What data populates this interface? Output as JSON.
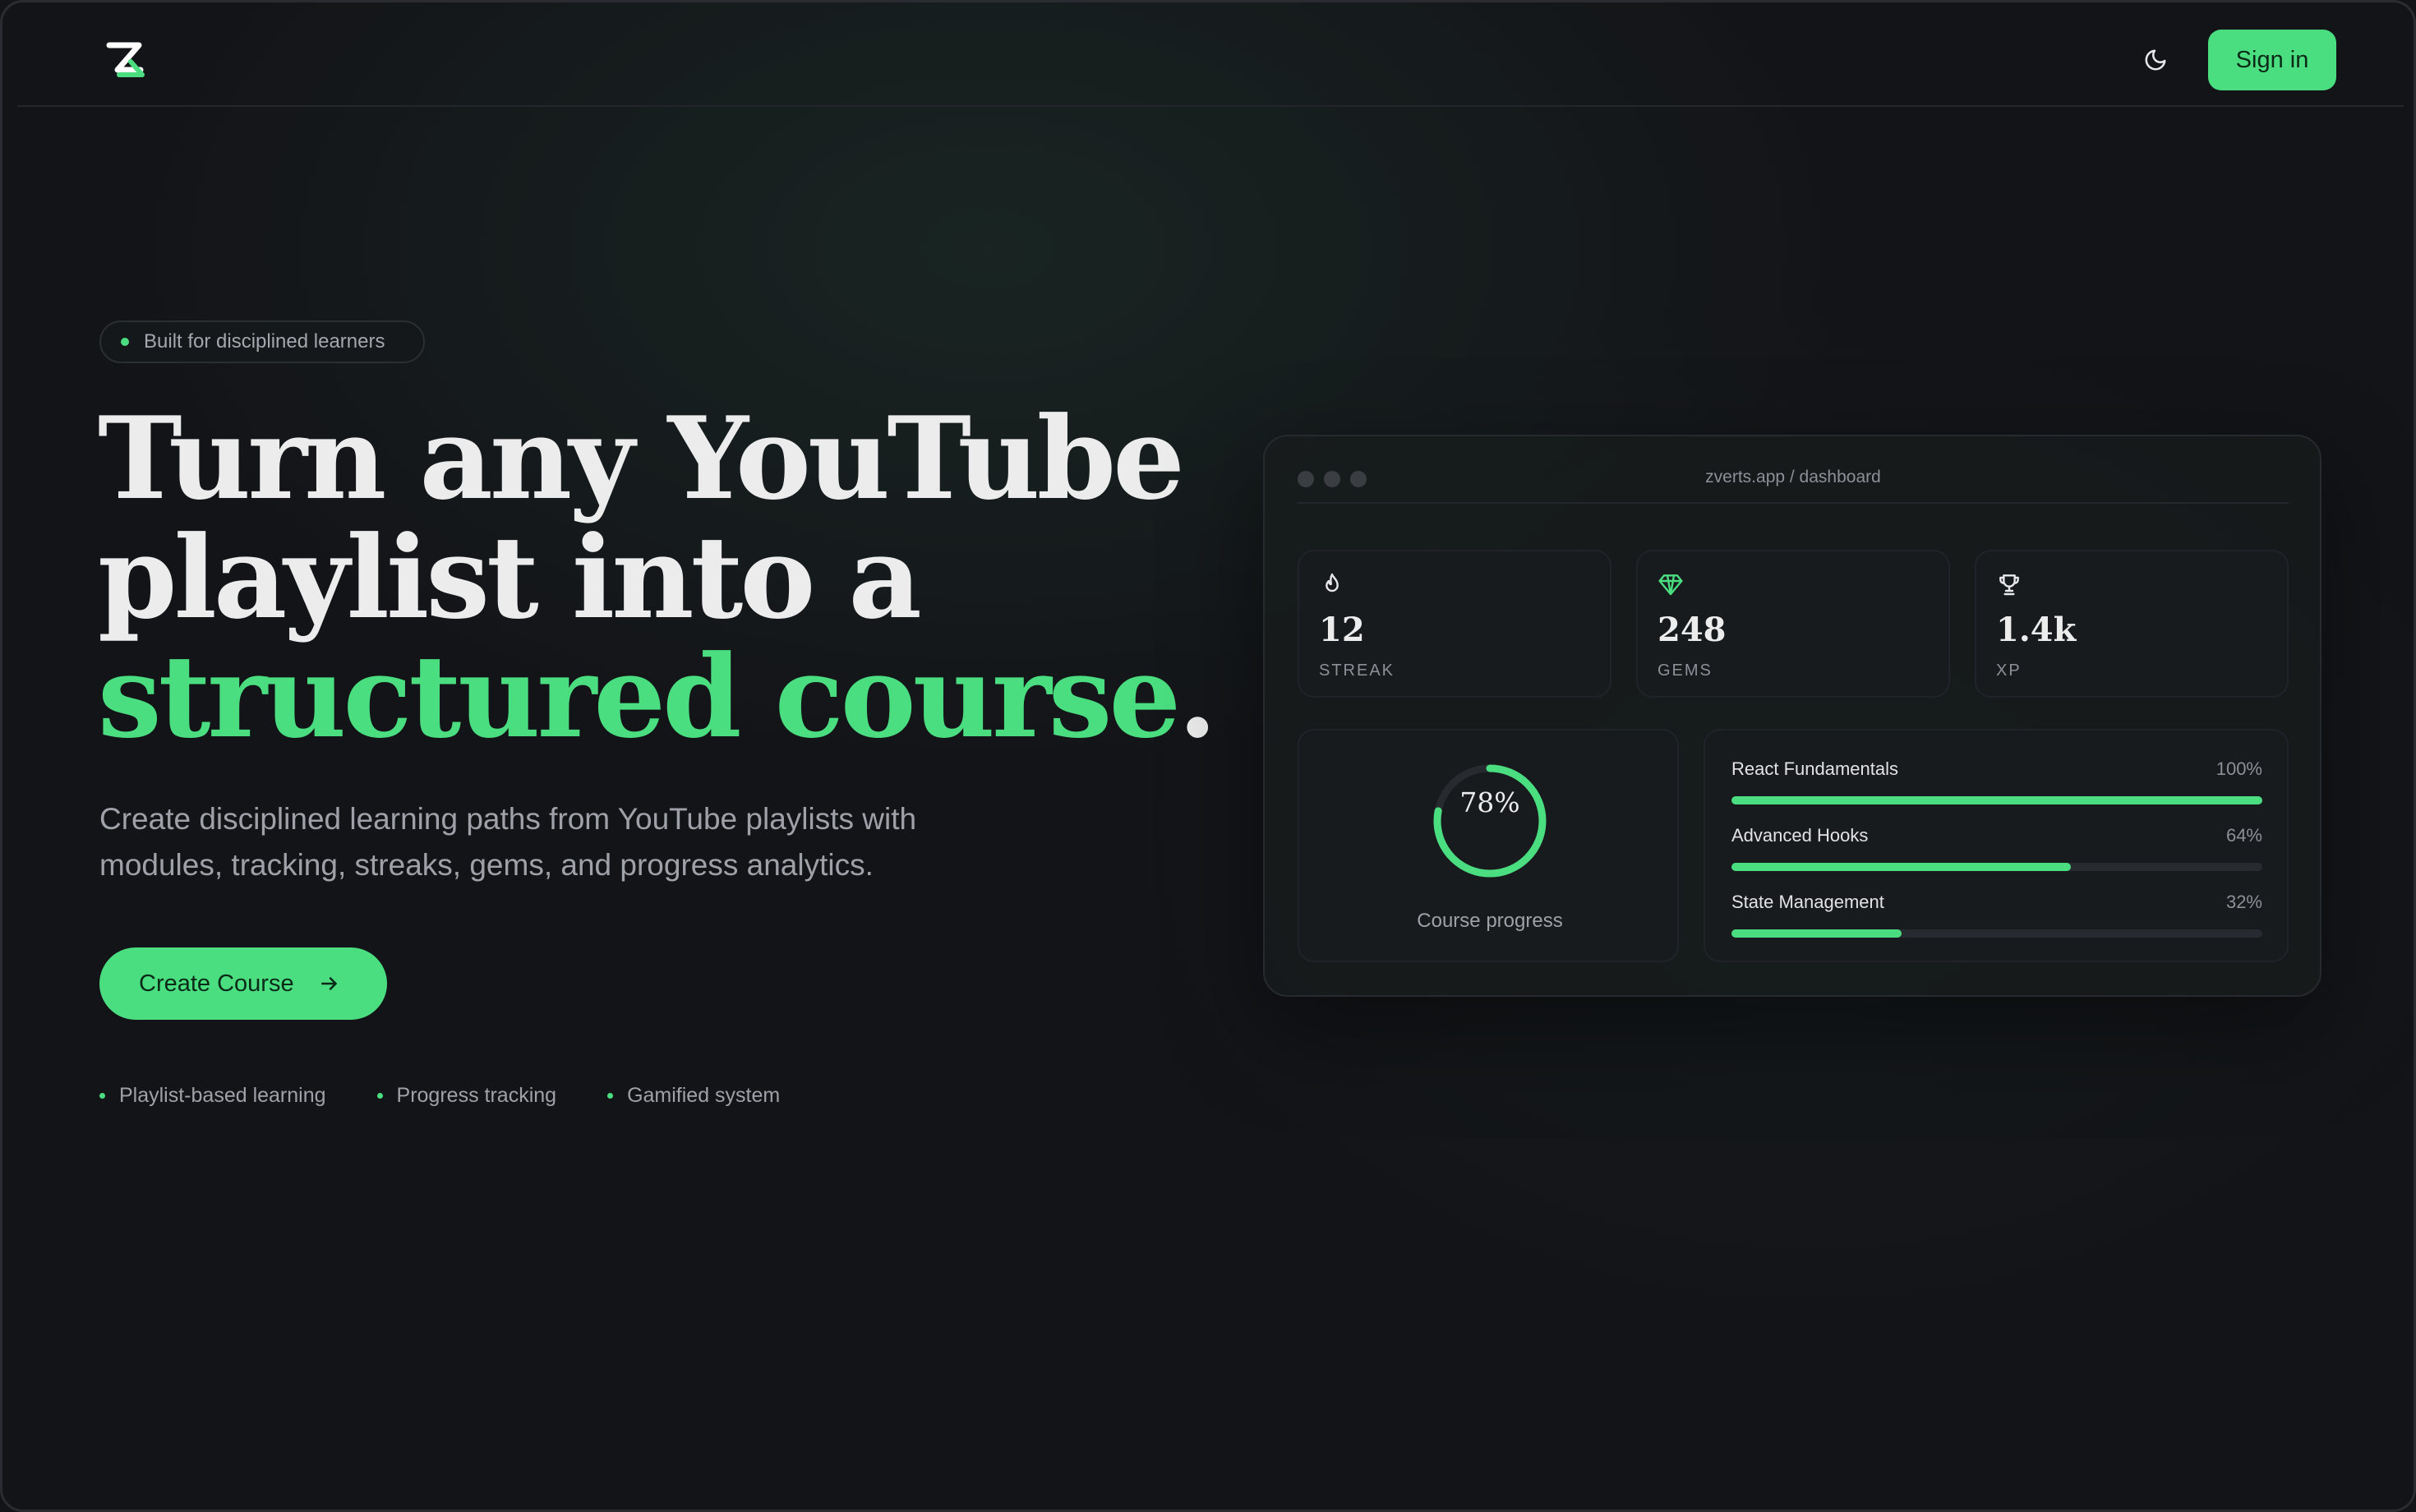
{
  "header": {
    "logo_alt": "Z logo",
    "signin_label": "Sign in"
  },
  "hero": {
    "badge": "Built for disciplined learners",
    "title_line1": "Turn any YouTube",
    "title_line2": "playlist into a",
    "title_accent": "structured course",
    "title_period": ".",
    "subtitle": "Create disciplined learning paths from YouTube playlists with modules, tracking, streaks, gems, and progress analytics.",
    "cta_label": "Create Course",
    "features": [
      "Playlist-based learning",
      "Progress tracking",
      "Gamified system"
    ]
  },
  "dashboard": {
    "url": "zverts.app / dashboard",
    "stats": [
      {
        "icon": "flame-icon",
        "value": "12",
        "label": "STREAK"
      },
      {
        "icon": "gem-icon",
        "value": "248",
        "label": "GEMS"
      },
      {
        "icon": "trophy-icon",
        "value": "1.4k",
        "label": "XP"
      }
    ],
    "progress": {
      "value": 78,
      "label": "78%",
      "caption": "Course progress"
    },
    "modules": [
      {
        "name": "React Fundamentals",
        "percent": 100,
        "label": "100%"
      },
      {
        "name": "Advanced Hooks",
        "percent": 64,
        "label": "64%"
      },
      {
        "name": "State Management",
        "percent": 32,
        "label": "32%"
      }
    ]
  },
  "colors": {
    "accent": "#4ade80",
    "background": "#131418",
    "text": "#ececec",
    "muted": "#9ea2a8"
  }
}
